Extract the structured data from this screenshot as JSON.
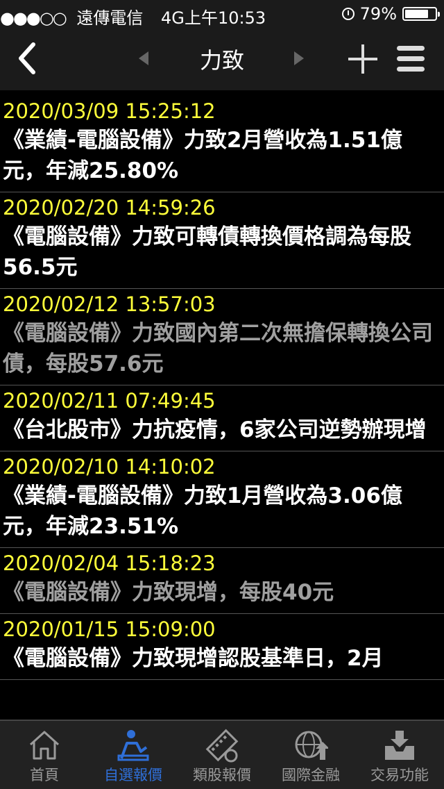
{
  "status_bar": {
    "carrier": "遠傳電信",
    "network": "4G",
    "time": "上午10:53",
    "battery": "79%",
    "battery_level": 0.79
  },
  "nav": {
    "title": "力致",
    "back_icon": "chevron-left-icon",
    "prev_icon": "triangle-left-icon",
    "next_icon": "triangle-right-icon",
    "add_icon": "plus-icon",
    "menu_icon": "hamburger-menu-icon"
  },
  "news": [
    {
      "date": "2020/03/09 15:25:12",
      "headline": "《業績-電腦設備》力致2月營收為1.51億元，年減25.80%",
      "read": false
    },
    {
      "date": "2020/02/20 14:59:26",
      "headline": "《電腦設備》力致可轉債轉換價格調為每股56.5元",
      "read": false
    },
    {
      "date": "2020/02/12 13:57:03",
      "headline": "《電腦設備》力致國內第二次無擔保轉換公司債，每股57.6元",
      "read": true
    },
    {
      "date": "2020/02/11 07:49:45",
      "headline": "《台北股市》力抗疫情，6家公司逆勢辦現增",
      "read": false
    },
    {
      "date": "2020/02/10 14:10:02",
      "headline": "《業績-電腦設備》力致1月營收為3.06億元，年減23.51%",
      "read": false
    },
    {
      "date": "2020/02/04 15:18:23",
      "headline": "《電腦設備》力致現增，每股40元",
      "read": true
    },
    {
      "date": "2020/01/15 15:09:00",
      "headline": "《電腦設備》力致現增認股基準日，2月",
      "read": false
    }
  ],
  "tabbar": {
    "tabs": [
      {
        "label": "首頁",
        "icon": "home-icon"
      },
      {
        "label": "自選報價",
        "icon": "person-chart-icon"
      },
      {
        "label": "類股報價",
        "icon": "film-coin-icon"
      },
      {
        "label": "國際金融",
        "icon": "globe-arrow-icon"
      },
      {
        "label": "交易功能",
        "icon": "inbox-download-icon"
      }
    ],
    "active_index": 1
  },
  "colors": {
    "date": "#ffff3a",
    "active_tab": "#2f6fd8",
    "inactive_tab": "#9a9a9a",
    "read_headline": "#a0a0a0"
  }
}
